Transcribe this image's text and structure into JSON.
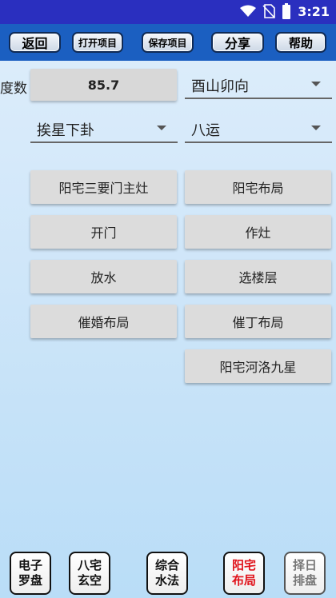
{
  "status": {
    "time": "3:21"
  },
  "toolbar": {
    "back": "返回",
    "open_project": "打开项目",
    "save_project": "保存项目",
    "share": "分享",
    "help": "帮助"
  },
  "form": {
    "degree_label": "度数",
    "degree_value": "85.7",
    "direction": "酉山卯向",
    "method": "挨星下卦",
    "period": "八运"
  },
  "actions": [
    "阳宅三要门主灶",
    "阳宅布局",
    "开门",
    "作灶",
    "放水",
    "选楼层",
    "催婚布局",
    "催丁布局",
    "阳宅河洛九星"
  ],
  "bottom_nav": {
    "compass": "电子罗盘",
    "bazhai": "八宅玄空",
    "water": "综合水法",
    "yangzhai": "阳宅布局",
    "date": "择日排盘"
  },
  "colors": {
    "status_bar": "#2a2fbf",
    "toolbar": "#1b5fc1",
    "active_nav": "#e0121a"
  }
}
